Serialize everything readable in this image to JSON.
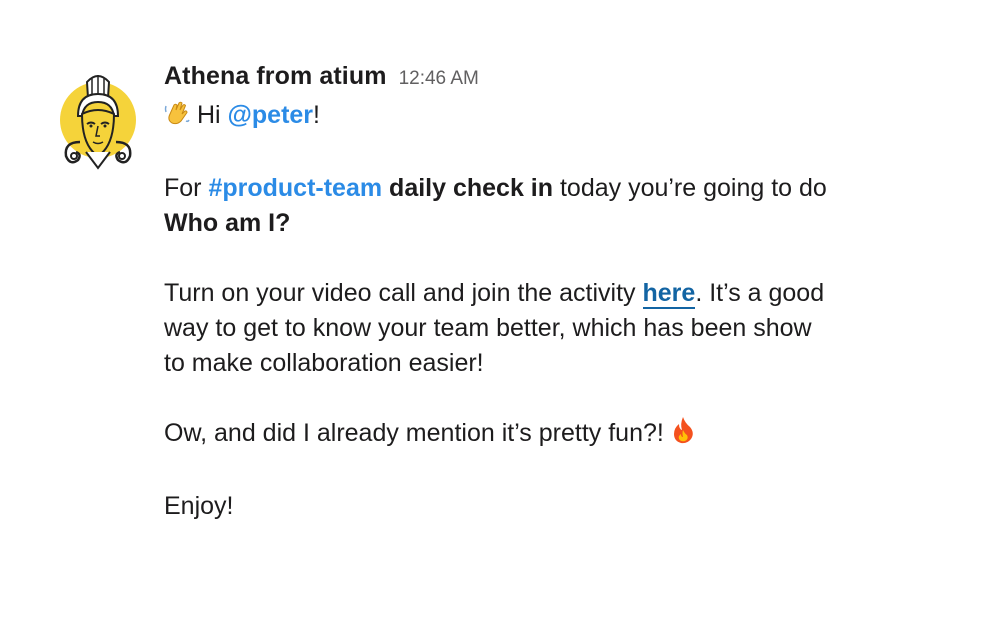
{
  "message": {
    "sender": "Athena from atium",
    "timestamp": "12:46 AM",
    "greeting_prefix": "Hi",
    "mention": "@peter",
    "greeting_suffix": "!",
    "p2": {
      "prefix": "For",
      "channel": "#product-team",
      "bold_text": "daily check in",
      "rest": "today you’re going to do",
      "activity": "Who am I?"
    },
    "p3": {
      "line1_prefix": "Turn on your video call and join the activity",
      "link": "here",
      "line1_suffix": ". It’s a good",
      "line2": "way to get to know your team better, which has been show",
      "line3": "to make collaboration easier!"
    },
    "p4": "Ow, and did I already mention it’s pretty fun?!",
    "p5": "Enjoy!"
  },
  "icons": {
    "avatar": "athena-helmet-avatar",
    "wave": "waving-hand-emoji",
    "fire": "fire-emoji"
  },
  "colors": {
    "link": "#1264a3",
    "mention": "#2b8be6",
    "avatar_bg": "#f5d33a"
  }
}
